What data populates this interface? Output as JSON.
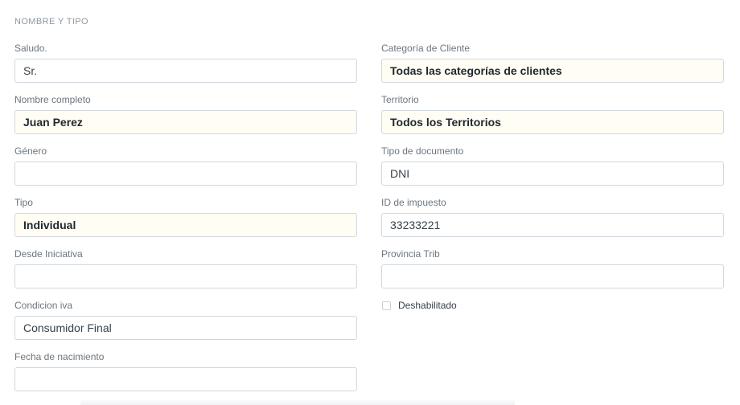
{
  "section": {
    "title": "NOMBRE Y TIPO"
  },
  "left_fields": [
    {
      "label": "Saludo.",
      "value": "Sr."
    },
    {
      "label": "Nombre completo",
      "value": "Juan Perez"
    },
    {
      "label": "Género",
      "value": ""
    },
    {
      "label": "Tipo",
      "value": "Individual"
    },
    {
      "label": "Desde Iniciativa",
      "value": ""
    },
    {
      "label": "Condicion iva",
      "value": "Consumidor Final"
    },
    {
      "label": "Fecha de nacimiento",
      "value": ""
    }
  ],
  "right_fields": [
    {
      "label": "Categoría de Cliente",
      "value": "Todas las categorías de clientes"
    },
    {
      "label": "Territorio",
      "value": "Todos los Territorios"
    },
    {
      "label": "Tipo de documento",
      "value": "DNI"
    },
    {
      "label": "ID de impuesto",
      "value": "33233221"
    },
    {
      "label": "Provincia Trib",
      "value": ""
    }
  ],
  "disabled_checkbox": {
    "label": "Deshabilitado",
    "checked": false
  }
}
